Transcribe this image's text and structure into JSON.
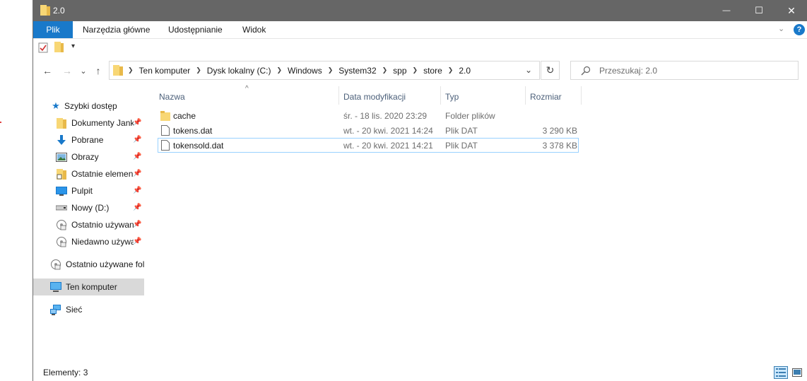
{
  "window": {
    "title": "2.0",
    "controls": {
      "minimize": "—",
      "maximize": "☐",
      "close": "✕"
    }
  },
  "ribbon": {
    "tabs": [
      "Plik",
      "Narzędzia główne",
      "Udostępnianie",
      "Widok"
    ],
    "help": "?"
  },
  "quick_access_toolbar": {
    "dropdown": "▾"
  },
  "navigation": {
    "back": "←",
    "forward": "→",
    "recent": "⌄",
    "up": "↑",
    "refresh": "↻",
    "breadcrumb": [
      "Ten komputer",
      "Dysk lokalny (C:)",
      "Windows",
      "System32",
      "spp",
      "store",
      "2.0"
    ],
    "search_placeholder": "Przeszukaj: 2.0"
  },
  "sidebar": {
    "items": [
      {
        "label": "Szybki dostęp",
        "icon": "star-icon",
        "pinned": false
      },
      {
        "label": "Dokumenty Jank",
        "icon": "folder-icon",
        "pinned": true
      },
      {
        "label": "Pobrane",
        "icon": "download-arrow-icon",
        "pinned": true
      },
      {
        "label": "Obrazy",
        "icon": "pictures-icon",
        "pinned": true
      },
      {
        "label": "Ostatnie elemen",
        "icon": "recent-folder-icon",
        "pinned": true
      },
      {
        "label": "Pulpit",
        "icon": "desktop-icon",
        "pinned": true
      },
      {
        "label": "Nowy (D:)",
        "icon": "drive-icon",
        "pinned": true
      },
      {
        "label": "Ostatnio używan",
        "icon": "network-folder-icon",
        "pinned": true
      },
      {
        "label": "Niedawno używa",
        "icon": "network-folder-icon",
        "pinned": true
      },
      {
        "label": "Ostatnio używane fol",
        "icon": "network-folder-icon",
        "pinned": false
      },
      {
        "label": "Ten komputer",
        "icon": "computer-icon",
        "pinned": false,
        "selected": true
      },
      {
        "label": "Sieć",
        "icon": "network-icon",
        "pinned": false
      }
    ]
  },
  "file_list": {
    "columns": [
      "Nazwa",
      "Data modyfikacji",
      "Typ",
      "Rozmiar"
    ],
    "sort_indicator": "^",
    "rows": [
      {
        "name": "cache",
        "date": "śr. - 18 lis. 2020 23:29",
        "type": "Folder plików",
        "size": "",
        "icon": "folder-icon"
      },
      {
        "name": "tokens.dat",
        "date": "wt. - 20 kwi. 2021 14:24",
        "type": "Plik DAT",
        "size": "3 290 KB",
        "icon": "file-icon"
      },
      {
        "name": "tokensold.dat",
        "date": "wt. - 20 kwi. 2021 14:21",
        "type": "Plik DAT",
        "size": "3 378 KB",
        "icon": "file-icon",
        "focused": true
      }
    ]
  },
  "status_bar": {
    "items_count": "Elementy: 3"
  },
  "colors": {
    "accent": "#1979ca",
    "titlebar": "#666666",
    "folder": "#f8d775",
    "selected": "#d9d9d9"
  }
}
